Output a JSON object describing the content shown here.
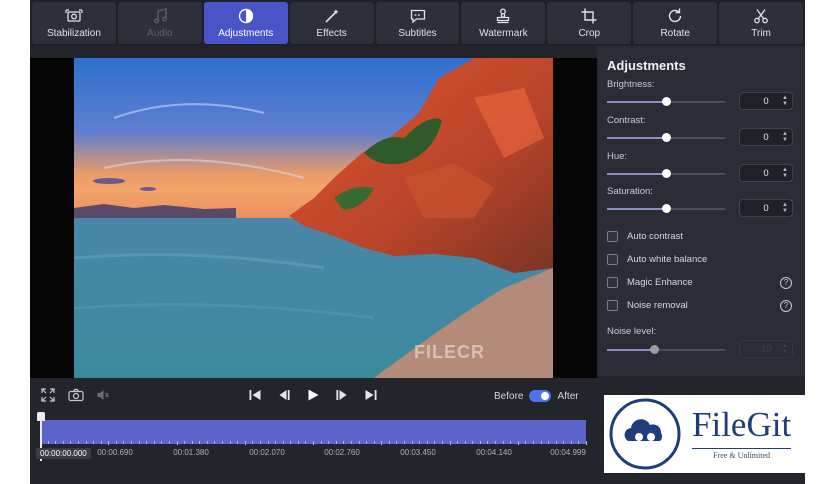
{
  "toolbar": {
    "tools": [
      {
        "label": "Stabilization",
        "icon": "stabilization-icon"
      },
      {
        "label": "Audio",
        "icon": "music-note-icon"
      },
      {
        "label": "Adjustments",
        "icon": "contrast-icon"
      },
      {
        "label": "Effects",
        "icon": "magic-wand-icon"
      },
      {
        "label": "Subtitles",
        "icon": "speech-bubble-icon"
      },
      {
        "label": "Watermark",
        "icon": "stamp-icon"
      },
      {
        "label": "Crop",
        "icon": "crop-icon"
      },
      {
        "label": "Rotate",
        "icon": "rotate-icon"
      },
      {
        "label": "Trim",
        "icon": "scissors-icon"
      }
    ],
    "active": "Adjustments",
    "disabled": "Audio"
  },
  "preview": {
    "watermark_text": "FILECR"
  },
  "panel": {
    "title": "Adjustments",
    "sliders": [
      {
        "label": "Brightness:",
        "value": "0",
        "level": 0.5
      },
      {
        "label": "Contrast:",
        "value": "0",
        "level": 0.5
      },
      {
        "label": "Hue:",
        "value": "0",
        "level": 0.5
      },
      {
        "label": "Saturation:",
        "value": "0",
        "level": 0.5
      }
    ],
    "checkboxes": [
      {
        "label": "Auto contrast",
        "checked": false,
        "help": false
      },
      {
        "label": "Auto white balance",
        "checked": false,
        "help": false
      },
      {
        "label": "Magic Enhance",
        "checked": false,
        "help": true
      },
      {
        "label": "Noise removal",
        "checked": false,
        "help": true
      }
    ],
    "noise_level": {
      "label": "Noise level:",
      "value": "10",
      "level": 0.4,
      "enabled": false
    }
  },
  "controls": {
    "before_label": "Before",
    "after_label": "After",
    "before_after_on": true
  },
  "timeline": {
    "current_time": "00:00:00.000",
    "marks": [
      "00:00.690",
      "00:01.380",
      "00:02.070",
      "00:02.760",
      "00:03.450",
      "00:04.140",
      "00:04.999"
    ]
  },
  "logo": {
    "name": "FileGit",
    "tagline": "Free & Unlimited"
  }
}
